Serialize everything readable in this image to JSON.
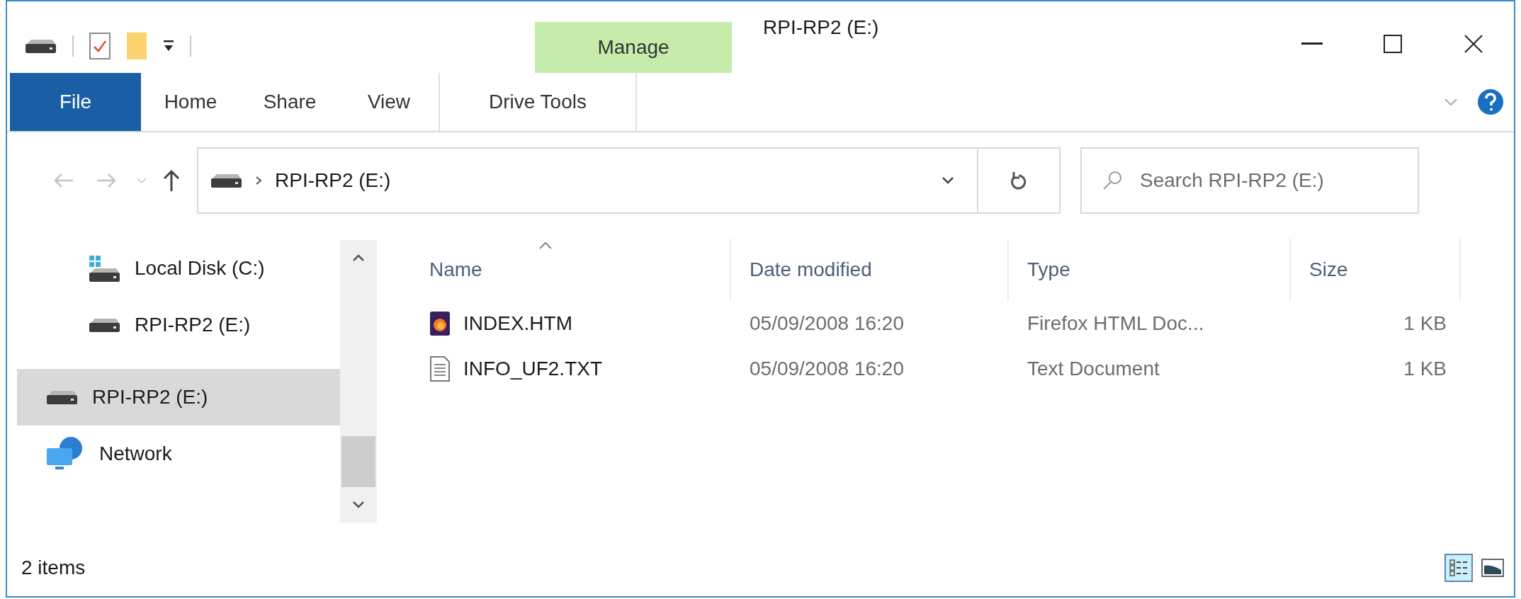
{
  "quick_access": [
    {
      "kind": "drive"
    },
    {
      "kind": "properties"
    },
    {
      "kind": "folder"
    },
    {
      "kind": "customize"
    }
  ],
  "context_tab": {
    "label": "Manage"
  },
  "window": {
    "title": "RPI-RP2 (E:)"
  },
  "ribbon_tabs": [
    {
      "label": "File",
      "kind": "file"
    },
    {
      "label": "Home",
      "kind": "tab"
    },
    {
      "label": "Share",
      "kind": "tab"
    },
    {
      "label": "View",
      "kind": "tab"
    },
    {
      "label": "Drive Tools",
      "kind": "context"
    }
  ],
  "address": {
    "path": "RPI-RP2 (E:)"
  },
  "search": {
    "placeholder": "Search RPI-RP2 (E:)"
  },
  "nav": {
    "this_pc_children": [
      {
        "label": "Local Disk (C:)",
        "kind": "system-drive",
        "selected": false
      },
      {
        "label": "RPI-RP2 (E:)",
        "kind": "drive",
        "selected": false
      }
    ],
    "items": [
      {
        "label": "RPI-RP2 (E:)",
        "kind": "drive",
        "selected": true
      },
      {
        "label": "Network",
        "kind": "network",
        "selected": false
      }
    ]
  },
  "table": {
    "columns": [
      {
        "label": "Name",
        "sorted": true
      },
      {
        "label": "Date modified",
        "sorted": false
      },
      {
        "label": "Type",
        "sorted": false
      },
      {
        "label": "Size",
        "sorted": false
      }
    ],
    "rows": [
      {
        "name": "INDEX.HTM",
        "kind": "firefox",
        "date": "05/09/2008 16:20",
        "type": "Firefox HTML Doc...",
        "size": "1 KB"
      },
      {
        "name": "INFO_UF2.TXT",
        "kind": "text",
        "date": "05/09/2008 16:20",
        "type": "Text Document",
        "size": "1 KB"
      }
    ]
  },
  "status_bar": {
    "count": "2 items",
    "views": [
      {
        "kind": "details",
        "selected": true
      },
      {
        "kind": "large-icons",
        "selected": false
      }
    ]
  }
}
